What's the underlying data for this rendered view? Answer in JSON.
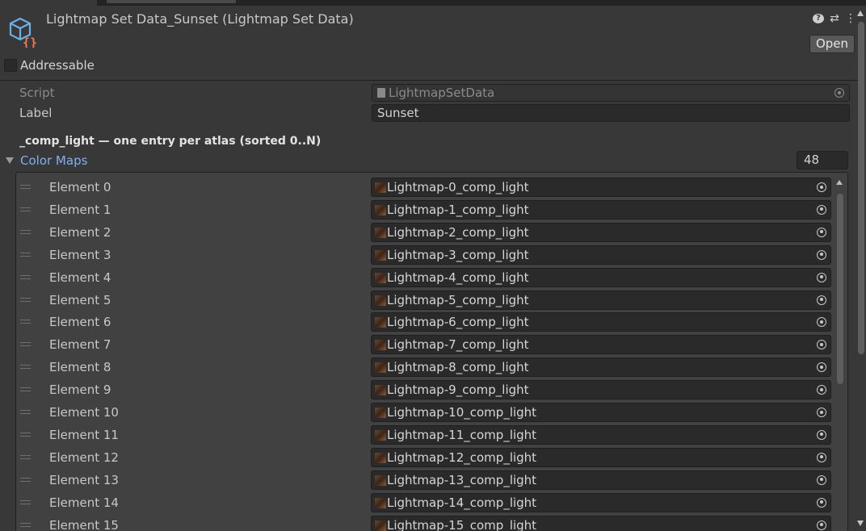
{
  "header": {
    "title": "Lightmap Set Data_Sunset (Lightmap Set Data)",
    "open_label": "Open",
    "icons": [
      "help-icon",
      "settings-sliders-icon",
      "more-menu-icon"
    ]
  },
  "addressable": {
    "label": "Addressable",
    "checked": false
  },
  "fields": {
    "script": {
      "label": "Script",
      "value": "LightmapSetData"
    },
    "label": {
      "label": "Label",
      "value": "Sunset"
    }
  },
  "section_header": "_comp_light — one entry per atlas (sorted 0..N)",
  "color_maps": {
    "label": "Color Maps",
    "size": "48",
    "elements": [
      {
        "label": "Element 0",
        "value": "Lightmap-0_comp_light"
      },
      {
        "label": "Element 1",
        "value": "Lightmap-1_comp_light"
      },
      {
        "label": "Element 2",
        "value": "Lightmap-2_comp_light"
      },
      {
        "label": "Element 3",
        "value": "Lightmap-3_comp_light"
      },
      {
        "label": "Element 4",
        "value": "Lightmap-4_comp_light"
      },
      {
        "label": "Element 5",
        "value": "Lightmap-5_comp_light"
      },
      {
        "label": "Element 6",
        "value": "Lightmap-6_comp_light"
      },
      {
        "label": "Element 7",
        "value": "Lightmap-7_comp_light"
      },
      {
        "label": "Element 8",
        "value": "Lightmap-8_comp_light"
      },
      {
        "label": "Element 9",
        "value": "Lightmap-9_comp_light"
      },
      {
        "label": "Element 10",
        "value": "Lightmap-10_comp_light"
      },
      {
        "label": "Element 11",
        "value": "Lightmap-11_comp_light"
      },
      {
        "label": "Element 12",
        "value": "Lightmap-12_comp_light"
      },
      {
        "label": "Element 13",
        "value": "Lightmap-13_comp_light"
      },
      {
        "label": "Element 14",
        "value": "Lightmap-14_comp_light"
      },
      {
        "label": "Element 15",
        "value": "Lightmap-15_comp_light"
      }
    ]
  }
}
